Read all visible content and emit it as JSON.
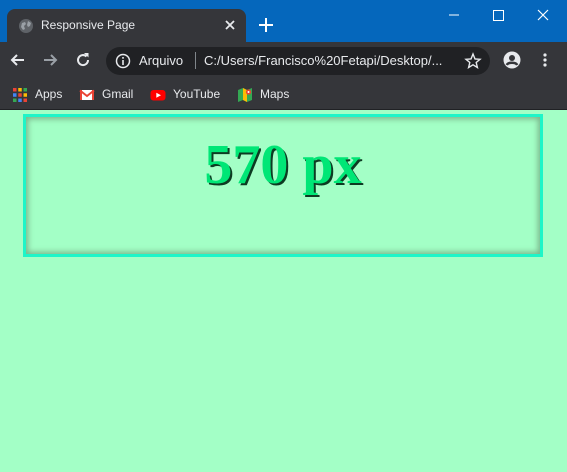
{
  "browser": {
    "tab": {
      "title": "Responsive Page",
      "favicon": "globe-icon"
    },
    "address_bar": {
      "security_label": "Arquivo",
      "url": "C:/Users/Francisco%20Fetapi/Desktop/..."
    },
    "bookmarks": [
      {
        "label": "Apps",
        "icon": "apps-grid-icon"
      },
      {
        "label": "Gmail",
        "icon": "gmail-icon"
      },
      {
        "label": "YouTube",
        "icon": "youtube-icon"
      },
      {
        "label": "Maps",
        "icon": "maps-icon"
      }
    ]
  },
  "page": {
    "width_text": "570 px"
  },
  "colors": {
    "titlebar": "#0567bc",
    "toolbar": "#35363a",
    "page_background": "#a3ffc6",
    "box_border": "#1ef5c8",
    "text": "#00e676"
  }
}
